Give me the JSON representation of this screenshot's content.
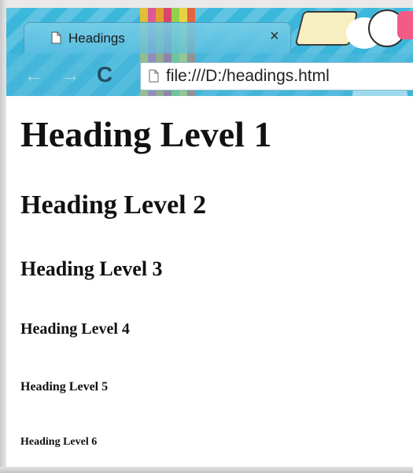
{
  "browser": {
    "tab": {
      "title": "Headings",
      "close_glyph": "×",
      "icon": "page-icon"
    },
    "toolbar": {
      "back_glyph": "←",
      "forward_glyph": "→",
      "reload_glyph": "C",
      "address": "file:///D:/headings.html",
      "address_icon": "page-icon"
    },
    "theme_colors": {
      "sky": "#3db8dd",
      "paper": "#f7efc2"
    }
  },
  "page": {
    "headings": [
      {
        "level": 1,
        "text": "Heading Level 1"
      },
      {
        "level": 2,
        "text": "Heading Level 2"
      },
      {
        "level": 3,
        "text": "Heading Level 3"
      },
      {
        "level": 4,
        "text": "Heading Level 4"
      },
      {
        "level": 5,
        "text": "Heading Level 5"
      },
      {
        "level": 6,
        "text": "Heading Level 6"
      }
    ]
  }
}
